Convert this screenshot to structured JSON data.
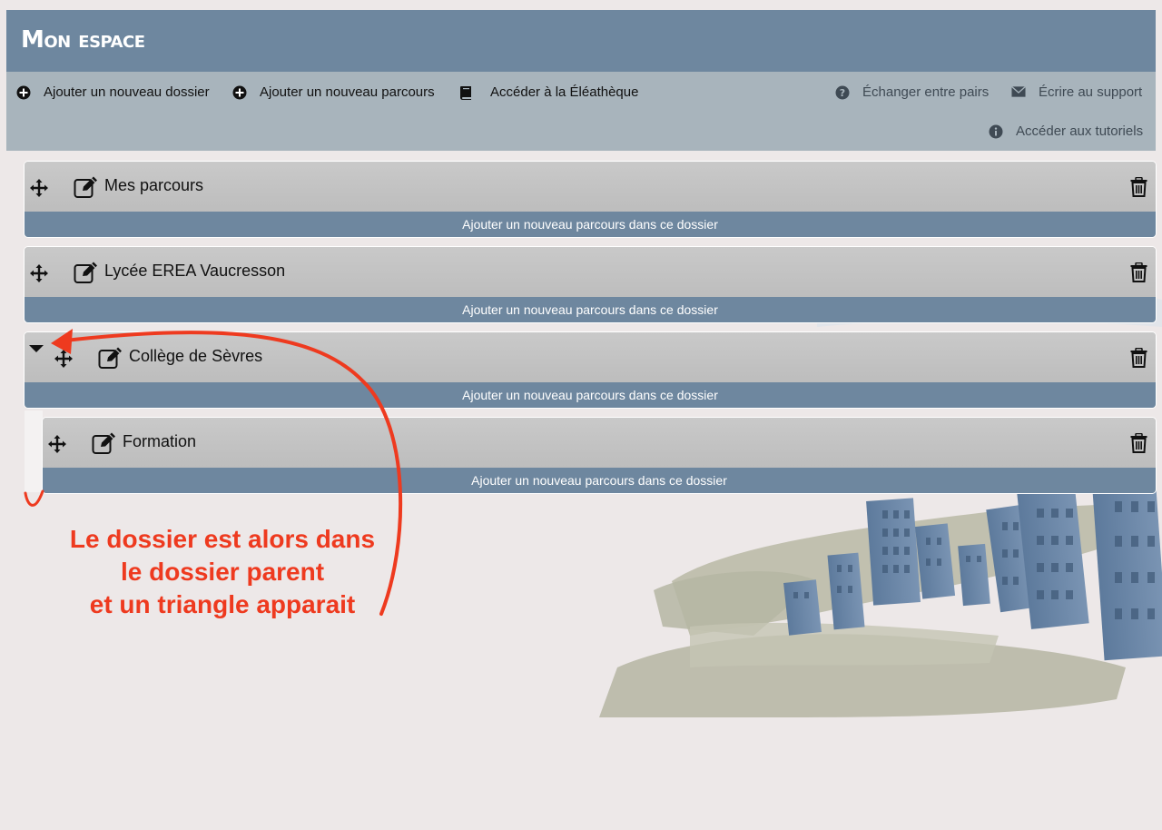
{
  "header": {
    "title": "Mon espace"
  },
  "toolbar": {
    "add_folder": "Ajouter un nouveau dossier",
    "add_course": "Ajouter un nouveau parcours",
    "library": "Accéder à la Éléathèque",
    "peers": "Échanger entre pairs",
    "support": "Écrire au support",
    "tutorials": "Accéder aux tutoriels"
  },
  "folders": [
    {
      "title": "Mes parcours",
      "footer": "Ajouter un nouveau parcours dans ce dossier"
    },
    {
      "title": "Lycée EREA Vaucresson",
      "footer": "Ajouter un nouveau parcours dans ce dossier"
    },
    {
      "title": "Collège de Sèvres",
      "footer": "Ajouter un nouveau parcours dans ce dossier",
      "expanded": true
    },
    {
      "title": "Formation",
      "footer": "Ajouter un nouveau parcours dans ce dossier",
      "child_of": "Collège de Sèvres"
    }
  ],
  "annotation": {
    "line1": "Le dossier est alors dans",
    "line2": "le dossier parent",
    "line3": "et un triangle apparait"
  },
  "colors": {
    "header": "#6e879f",
    "toolbar": "#a8b4bc",
    "folder": "#c4c4c4",
    "folder_footer": "#6e879f",
    "annotation": "#ee3a1f",
    "background": "#ede8e8"
  },
  "icons": {
    "toolbar": [
      "plus-circle-icon",
      "plus-circle-icon",
      "book-icon",
      "question-circle-icon",
      "envelope-icon",
      "info-circle-icon"
    ],
    "folder": [
      "move-icon",
      "edit-icon",
      "trash-icon",
      "triangle-down-icon"
    ]
  }
}
